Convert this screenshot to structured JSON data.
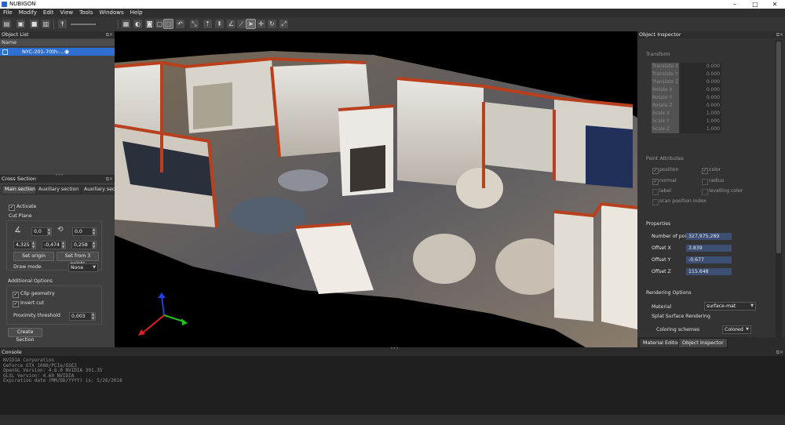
{
  "window": {
    "title": "NUBIGON",
    "minimize": "–",
    "maximize": "□",
    "close": "✕"
  },
  "menu": [
    "File",
    "Modify",
    "Edit",
    "View",
    "Tools",
    "Windows",
    "Help"
  ],
  "toolbar_icons": [
    "new-file-icon",
    "open-file-icon",
    "save-icon",
    "delete-icon",
    "walk-icon",
    "select-icon",
    "color-icon",
    "camera-icon",
    "screenshot-icon",
    "selection-icon",
    "lasso-icon",
    "annotate-icon",
    "pin-icon",
    "measure-icon",
    "measure-angle-icon",
    "cut-icon",
    "pointer-icon",
    "move-icon",
    "rotate-icon",
    "scale-icon"
  ],
  "object_list": {
    "title": "Object List",
    "column": "Name",
    "items": [
      {
        "name": "NYC-201-70th-...",
        "checked": true
      }
    ]
  },
  "cross_section": {
    "title": "Cross Section",
    "tabs": [
      "Main section",
      "Auxiliary section 1",
      "Auxiliary sectio"
    ],
    "activate_label": "Activate",
    "cut_plane_label": "Cut Plane",
    "angle1": "0,0",
    "angle2": "0,0",
    "origin_x": "4,325",
    "origin_y": "-0,474",
    "origin_z": "0,258",
    "set_origin": "Set origin",
    "set_from_points": "Set from 3 points",
    "draw_mode_label": "Draw mode",
    "draw_mode_value": "None",
    "additional_label": "Additional Options",
    "clip_label": "Clip geometry",
    "invert_label": "Invert cut",
    "proximity_label": "Proximity threshold",
    "proximity_value": "0,003",
    "create_button": "Create Section"
  },
  "inspector": {
    "title": "Object Inspector",
    "transform_label": "Transform",
    "transform": [
      {
        "k": "Translate X",
        "v": "0.000"
      },
      {
        "k": "Translate Y",
        "v": "0.000"
      },
      {
        "k": "Translate Z",
        "v": "0.000"
      },
      {
        "k": "Rotate X",
        "v": "0.000"
      },
      {
        "k": "Rotate Y",
        "v": "0.000"
      },
      {
        "k": "Rotate Z",
        "v": "0.000"
      },
      {
        "k": "Scale X",
        "v": "1.000"
      },
      {
        "k": "Scale Y",
        "v": "1.000"
      },
      {
        "k": "Scale Z",
        "v": "1.000"
      }
    ],
    "point_attributes_label": "Point Attributes",
    "attributes": {
      "position": "position",
      "color": "color",
      "normal": "normal",
      "radius": "radius",
      "label": "label",
      "levelling_color": "levelling color",
      "scan_position_index": "scan position index"
    },
    "properties_label": "Properties",
    "properties": [
      {
        "k": "Number of points",
        "v": "327,975,289"
      },
      {
        "k": "Offset X",
        "v": "3.839"
      },
      {
        "k": "Offset Y",
        "v": "-0.677"
      },
      {
        "k": "Offset Z",
        "v": "115.648"
      }
    ],
    "rendering_label": "Rendering Options",
    "material_label": "Material",
    "material_value": "surface-mat",
    "splat_label": "Splat Surface Rendering",
    "coloring_label": "Coloring schemes",
    "coloring_value": "Colored"
  },
  "bottom_tabs": [
    "Material Editor",
    "Object Inspector"
  ],
  "console": {
    "title": "Console",
    "lines": "NVIDIA Corporation\nGeForce GTX 1080/PCIe/SSE2\nOpenGL Version: 4.6.0 NVIDIA 391.35\nGLSL Version: 4.60 NVIDIA\nExpiration date (MM/DD/YYYY) is: 5/26/2018"
  },
  "colors": {
    "accent": "#2f6fd2",
    "section_edge": "#b8401c",
    "axis_x": "#e02020",
    "axis_y": "#20c020",
    "axis_z": "#2040e0"
  }
}
